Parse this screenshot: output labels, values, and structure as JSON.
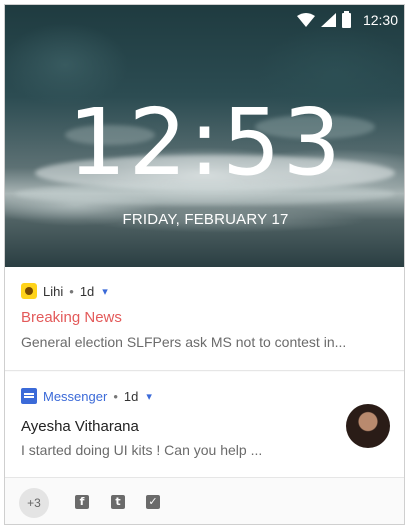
{
  "status_bar": {
    "time": "12:30",
    "icons": [
      "wifi-icon",
      "signal-icon",
      "battery-icon"
    ]
  },
  "lock_screen": {
    "clock": "12:53",
    "date": "FRIDAY, FEBRUARY 17"
  },
  "notifications": [
    {
      "app": "Lihi",
      "separator": "•",
      "time_ago": "1d",
      "title": "Breaking News",
      "body": "General election SLFPers ask MS not to contest in...",
      "icon": "lihi-app-icon"
    },
    {
      "app": "Messenger",
      "separator": "•",
      "time_ago": "1d",
      "title": "Ayesha Vitharana",
      "body": "I started doing UI kits ! Can you help ...",
      "icon": "messenger-app-icon"
    }
  ],
  "overflow": {
    "more_count": "+3",
    "icons": [
      "facebook-icon",
      "tumblr-icon",
      "twitter-icon"
    ],
    "facebook_glyph": "f",
    "tumblr_glyph": "t",
    "twitter_glyph": "✓"
  },
  "colors": {
    "accent_blue": "#3b6ad8",
    "breaking_red": "#e35a5a",
    "lihi_yellow": "#ffd31a"
  }
}
